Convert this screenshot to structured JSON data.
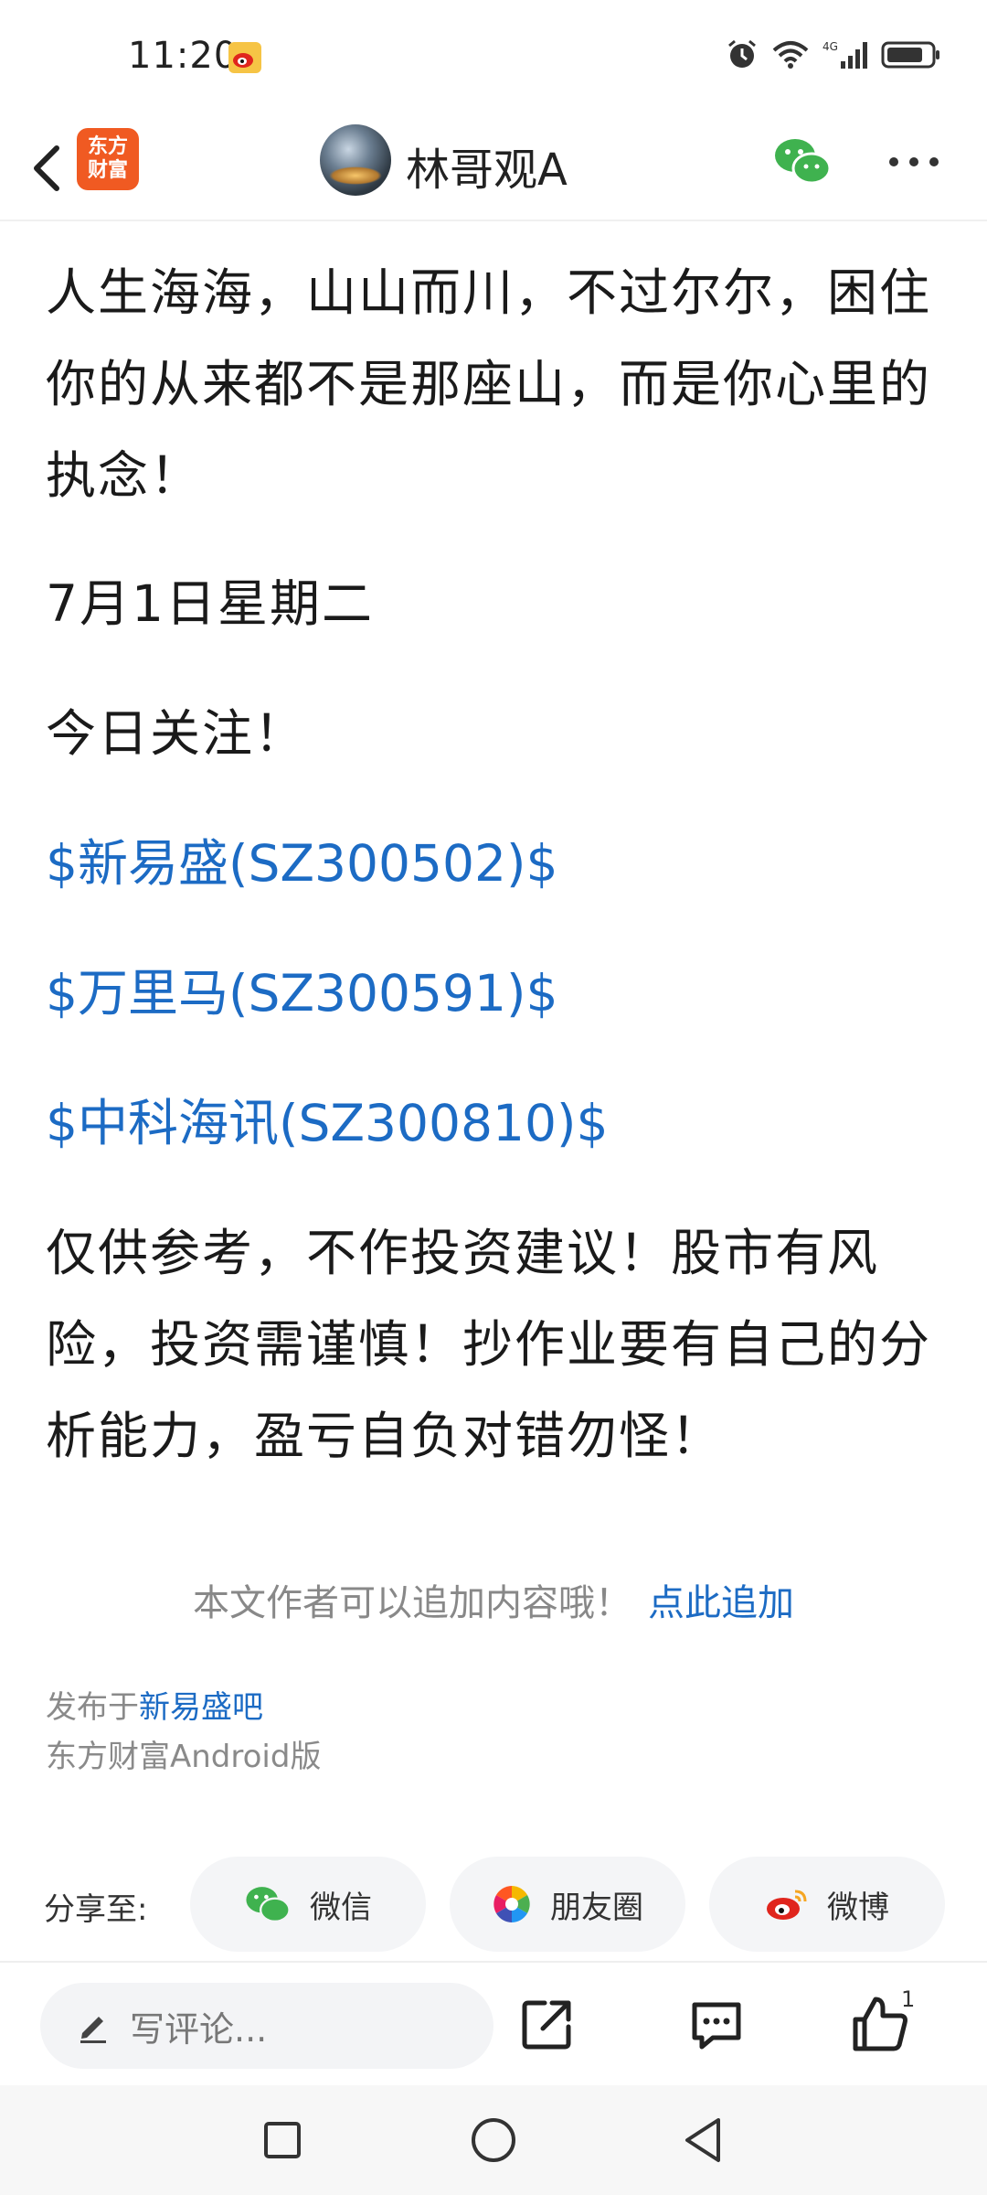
{
  "status_bar": {
    "time": "11:20",
    "icons": [
      "weibo-icon",
      "alarm-icon",
      "wifi-icon",
      "4g-signal-icon",
      "battery-icon"
    ]
  },
  "header": {
    "app_logo_line1": "东方",
    "app_logo_line2": "财富",
    "author": "林哥观A",
    "icons": [
      "back-icon",
      "wechat-icon",
      "more-icon"
    ]
  },
  "article": {
    "intro": "人生海海，山山而川，不过尔尔，困住你的从来都不是那座山，而是你心里的执念！",
    "date": "7月1日星期二",
    "focus": "今日关注！",
    "stocks": [
      "$新易盛(SZ300502)$",
      "$万里马(SZ300591)$",
      "$中科海讯(SZ300810)$"
    ],
    "disclaimer": "仅供参考，不作投资建议！股市有风险，投资需谨慎！抄作业要有自己的分析能力，盈亏自负对错勿怪！"
  },
  "append": {
    "text": "本文作者可以追加内容哦！",
    "link": "点此追加"
  },
  "meta": {
    "posted_prefix": "发布于",
    "bar_name": "新易盛吧",
    "client": "东方财富Android版"
  },
  "share": {
    "label": "分享至:",
    "wechat": "微信",
    "moments": "朋友圈",
    "weibo": "微博"
  },
  "bottom_bar": {
    "comment_placeholder": "写评论...",
    "like_count": "1"
  },
  "colors": {
    "link_blue": "#1c6bc4",
    "brand_orange": "#f05a22",
    "wechat_green": "#3fb24f",
    "weibo_red": "#e0251d"
  }
}
